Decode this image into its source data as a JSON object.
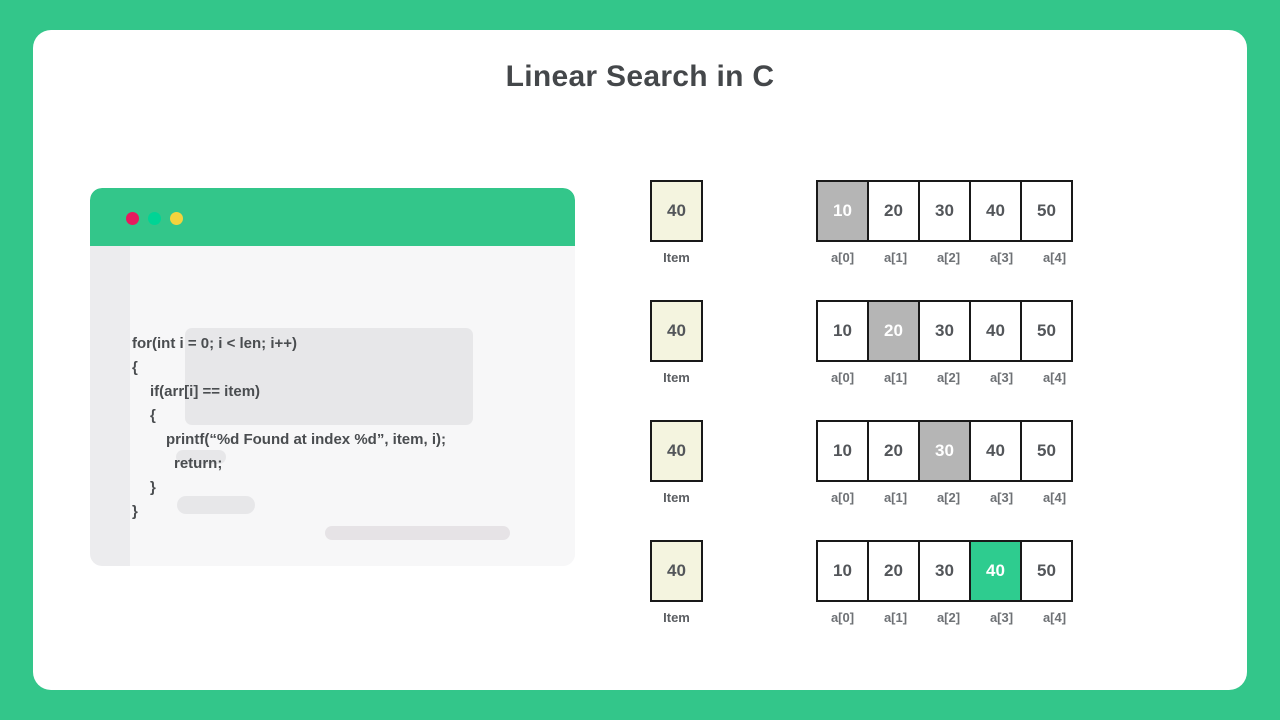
{
  "theme": {
    "background_green": "#33C68A",
    "card_white": "#FFFFFF",
    "scan_gray": "#B5B5B5",
    "found_green": "#2ECC8F",
    "item_cream": "#F4F4DF",
    "text_dark": "#44474A"
  },
  "header": {
    "title": "Linear Search in C"
  },
  "code_window": {
    "dots": [
      "close-red",
      "minimize-green",
      "maximize-yellow"
    ],
    "lines": [
      "for(int i = 0; i < len; i++)",
      "{",
      "if(arr[i] == item)",
      "{",
      "printf(“%d Found at index %d”, item, i);",
      "return;",
      "}",
      "}"
    ]
  },
  "diagram": {
    "item_label": "Item",
    "indices": [
      "a[0]",
      "a[1]",
      "a[2]",
      "a[3]",
      "a[4]"
    ],
    "array_values": [
      "10",
      "20",
      "30",
      "40",
      "50"
    ],
    "steps": [
      {
        "item": "40",
        "values": [
          "10",
          "20",
          "30",
          "40",
          "50"
        ],
        "highlight": 0,
        "state": "scan"
      },
      {
        "item": "40",
        "values": [
          "10",
          "20",
          "30",
          "40",
          "50"
        ],
        "highlight": 1,
        "state": "scan"
      },
      {
        "item": "40",
        "values": [
          "10",
          "20",
          "30",
          "40",
          "50"
        ],
        "highlight": 2,
        "state": "scan"
      },
      {
        "item": "40",
        "values": [
          "10",
          "20",
          "30",
          "40",
          "50"
        ],
        "highlight": 3,
        "state": "found"
      }
    ]
  }
}
